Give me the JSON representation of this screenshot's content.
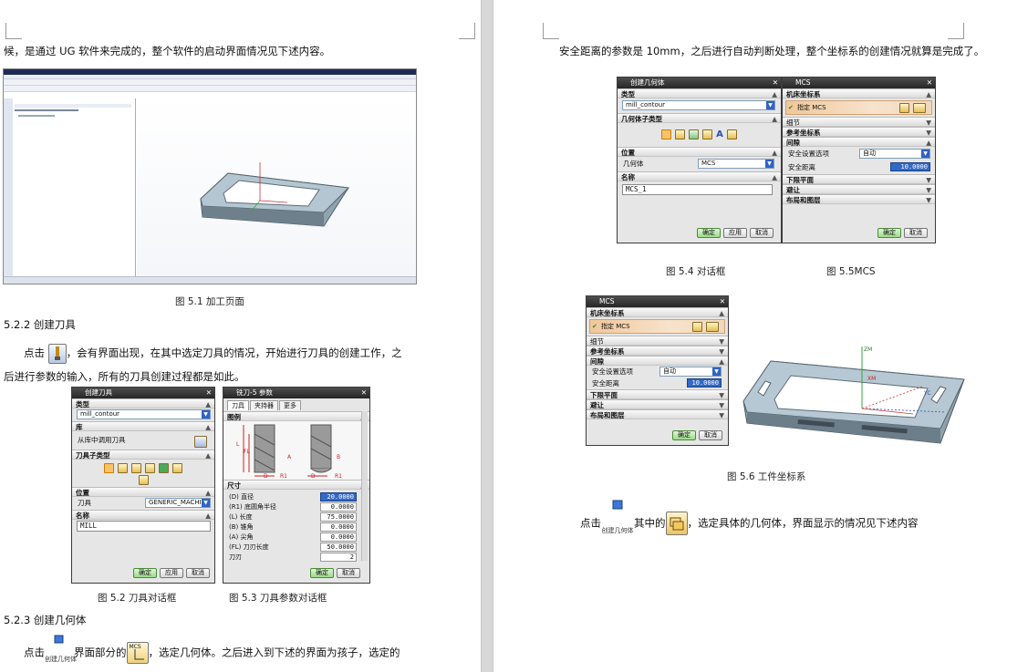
{
  "left_page": {
    "intro_text": "候，是通过 UG 软件来完成的，整个软件的启动界面情况见下述内容。",
    "fig51_caption": "图 5.1 加工页面",
    "sec522_heading": "5.2.2 创建刀具",
    "para522_line1_pre": "点击",
    "para522_line1_post": "，会有界面出现，在其中选定刀具的情况，开始进行刀具的创建工作，之",
    "para522_line2": "后进行参数的输入，所有的刀具创建过程都是如此。",
    "fig52_caption": "图 5.2 刀具对话框",
    "fig53_caption": "图 5.3 刀具参数对话框",
    "sec523_heading": "5.2.3 创建几何体",
    "para523_pre": "点击",
    "para523_icon_text": "创建几何体",
    "para523_mid": "界面部分的",
    "para523_post": "，选定几何体。之后进入到下述的界面为孩子，选定的",
    "mcs_icon_text": "MCS"
  },
  "right_page": {
    "intro_text": "安全距离的参数是 10mm，之后进行自动判断处理，整个坐标系的创建情况就算是完成了。",
    "fig54_caption": "图 5.4 对话框",
    "fig55_caption": "图 5.5MCS",
    "fig56_caption": "图 5.6 工件坐标系",
    "final_pre": "点击",
    "final_icon_text": "创建几何体",
    "final_mid": "其中的",
    "final_post": "，选定具体的几何体，界面显示的情况见下述内容"
  },
  "dlg_tool": {
    "title": "创建刀具",
    "sec_type": "类型",
    "type_value": "mill_contour",
    "sec_library": "库",
    "library_text": "从库中调用刀具",
    "sec_subtype": "刀具子类型",
    "sec_position": "位置",
    "position_label": "刀具",
    "position_value": "GENERIC_MACHINE",
    "sec_name": "名称",
    "name_value": "MILL",
    "btn_ok": "确定",
    "btn_apply": "应用",
    "btn_cancel": "取消"
  },
  "dlg_params": {
    "title": "铣刀-5 参数",
    "tabs": [
      "刀具",
      "夹持器",
      "更多"
    ],
    "sec_diagram": "图例",
    "sec_size": "尺寸",
    "params": [
      {
        "label": "(D) 直径",
        "value": "20.0000"
      },
      {
        "label": "(R1) 底圆角半径",
        "value": "0.0000"
      },
      {
        "label": "(L) 长度",
        "value": "75.0000"
      },
      {
        "label": "(B) 锥角",
        "value": "0.0000"
      },
      {
        "label": "(A) 尖角",
        "value": "0.0000"
      },
      {
        "label": "(FL) 刀刃长度",
        "value": "50.0000"
      },
      {
        "label": "刀刃",
        "value": "2"
      }
    ],
    "labels_fig": [
      "FL",
      "L",
      "D",
      "A",
      "B",
      "R1",
      "D",
      "R1"
    ],
    "btn_ok": "确定",
    "btn_cancel": "取消"
  },
  "dlg_geom": {
    "title": "创建几何体",
    "sec_type": "类型",
    "type_value": "mill_contour",
    "sec_subtype": "几何体子类型",
    "sec_position": "位置",
    "position_label": "几何体",
    "position_value": "MCS",
    "sec_name": "名称",
    "name_value": "MCS_1",
    "btn_ok": "确定",
    "btn_apply": "应用",
    "btn_cancel": "取消"
  },
  "dlg_mcs": {
    "title": "MCS",
    "sec_machine": "机床坐标系",
    "specify": "指定 MCS",
    "detail": "细节",
    "sec_ref": "参考坐标系",
    "sec_clear": "间隙",
    "opt_label": "安全设置选项",
    "opt_value": "自动",
    "dist_label": "安全距离",
    "dist_value": "10.0000",
    "sec_lower": "下限平面",
    "sec_avoid": "避让",
    "sec_layout": "布局和图层",
    "btn_ok": "确定",
    "btn_cancel": "取消"
  },
  "cam": {
    "axis_labels": [
      "ZM",
      "XM",
      "YC"
    ]
  },
  "colors": {
    "dialog_title": "#2f2f2f",
    "ok_button": "#9bdc88",
    "highlight": "#3169c6",
    "part": "#a9bcc8"
  }
}
